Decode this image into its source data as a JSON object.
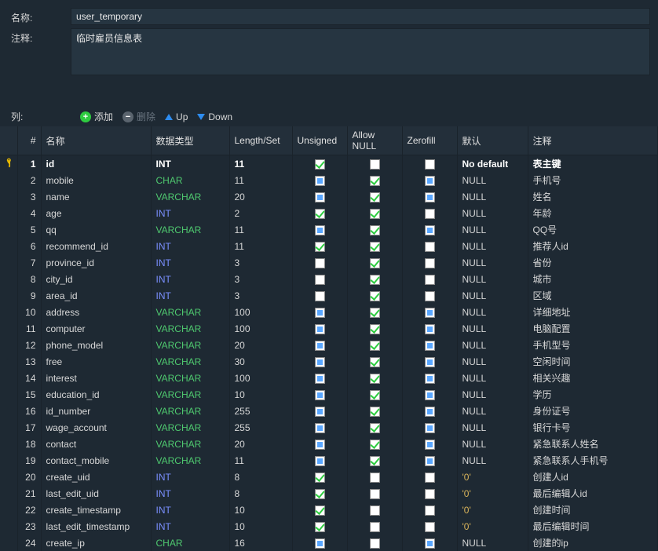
{
  "labels": {
    "name": "名称:",
    "comment": "注释:",
    "columns": "列:"
  },
  "form": {
    "name_value": "user_temporary",
    "comment_value": "临时雇员信息表"
  },
  "toolbar": {
    "add": "添加",
    "del": "删除",
    "up": "Up",
    "down": "Down"
  },
  "headers": {
    "num": "#",
    "name": "名称",
    "datatype": "数据类型",
    "length": "Length/Set",
    "unsigned": "Unsigned",
    "allownull": "Allow NULL",
    "zerofill": "Zerofill",
    "default": "默认",
    "comment": "注释"
  },
  "rows": [
    {
      "n": 1,
      "key": true,
      "name": "id",
      "type": "INT",
      "tclass": "dt-int",
      "len": "11",
      "unsigned": true,
      "null": false,
      "zero": false,
      "def": "No default",
      "defc": "",
      "com": "表主键",
      "sel": true
    },
    {
      "n": 2,
      "name": "mobile",
      "type": "CHAR",
      "tclass": "dt-char",
      "len": "11",
      "unsigned": false,
      "null": true,
      "zero": false,
      "def": "NULL",
      "com": "手机号"
    },
    {
      "n": 3,
      "name": "name",
      "type": "VARCHAR",
      "tclass": "dt-varchar",
      "len": "20",
      "unsigned": false,
      "null": true,
      "zero": false,
      "def": "NULL",
      "com": "姓名"
    },
    {
      "n": 4,
      "name": "age",
      "type": "INT",
      "tclass": "dt-int",
      "len": "2",
      "unsigned": true,
      "null": true,
      "zero": false,
      "def": "NULL",
      "com": "年龄"
    },
    {
      "n": 5,
      "name": "qq",
      "type": "VARCHAR",
      "tclass": "dt-varchar",
      "len": "11",
      "unsigned": false,
      "null": true,
      "zero": false,
      "def": "NULL",
      "com": "QQ号"
    },
    {
      "n": 6,
      "name": "recommend_id",
      "type": "INT",
      "tclass": "dt-int",
      "len": "11",
      "unsigned": true,
      "null": true,
      "zero": false,
      "def": "NULL",
      "com": "推荐人id"
    },
    {
      "n": 7,
      "name": "province_id",
      "type": "INT",
      "tclass": "dt-int",
      "len": "3",
      "unsigned": false,
      "null": true,
      "zero": false,
      "def": "NULL",
      "com": "省份"
    },
    {
      "n": 8,
      "name": "city_id",
      "type": "INT",
      "tclass": "dt-int",
      "len": "3",
      "unsigned": false,
      "null": true,
      "zero": false,
      "def": "NULL",
      "com": "城市"
    },
    {
      "n": 9,
      "name": "area_id",
      "type": "INT",
      "tclass": "dt-int",
      "len": "3",
      "unsigned": false,
      "null": true,
      "zero": false,
      "def": "NULL",
      "com": "区域"
    },
    {
      "n": 10,
      "name": "address",
      "type": "VARCHAR",
      "tclass": "dt-varchar",
      "len": "100",
      "unsigned": false,
      "null": true,
      "zero": false,
      "def": "NULL",
      "com": "详细地址"
    },
    {
      "n": 11,
      "name": "computer",
      "type": "VARCHAR",
      "tclass": "dt-varchar",
      "len": "100",
      "unsigned": false,
      "null": true,
      "zero": false,
      "def": "NULL",
      "com": "电脑配置"
    },
    {
      "n": 12,
      "name": "phone_model",
      "type": "VARCHAR",
      "tclass": "dt-varchar",
      "len": "20",
      "unsigned": false,
      "null": true,
      "zero": false,
      "def": "NULL",
      "com": "手机型号"
    },
    {
      "n": 13,
      "name": "free",
      "type": "VARCHAR",
      "tclass": "dt-varchar",
      "len": "30",
      "unsigned": false,
      "null": true,
      "zero": false,
      "def": "NULL",
      "com": "空闲时间"
    },
    {
      "n": 14,
      "name": "interest",
      "type": "VARCHAR",
      "tclass": "dt-varchar",
      "len": "100",
      "unsigned": false,
      "null": true,
      "zero": false,
      "def": "NULL",
      "com": "相关兴趣"
    },
    {
      "n": 15,
      "name": "education_id",
      "type": "VARCHAR",
      "tclass": "dt-varchar",
      "len": "10",
      "unsigned": false,
      "null": true,
      "zero": false,
      "def": "NULL",
      "com": "学历"
    },
    {
      "n": 16,
      "name": "id_number",
      "type": "VARCHAR",
      "tclass": "dt-varchar",
      "len": "255",
      "unsigned": false,
      "null": true,
      "zero": false,
      "def": "NULL",
      "com": "身份证号"
    },
    {
      "n": 17,
      "name": "wage_account",
      "type": "VARCHAR",
      "tclass": "dt-varchar",
      "len": "255",
      "unsigned": false,
      "null": true,
      "zero": false,
      "def": "NULL",
      "com": "银行卡号"
    },
    {
      "n": 18,
      "name": "contact",
      "type": "VARCHAR",
      "tclass": "dt-varchar",
      "len": "20",
      "unsigned": false,
      "null": true,
      "zero": false,
      "def": "NULL",
      "com": "紧急联系人姓名"
    },
    {
      "n": 19,
      "name": "contact_mobile",
      "type": "VARCHAR",
      "tclass": "dt-varchar",
      "len": "11",
      "unsigned": false,
      "null": true,
      "zero": false,
      "def": "NULL",
      "com": "紧急联系人手机号"
    },
    {
      "n": 20,
      "name": "create_uid",
      "type": "INT",
      "tclass": "dt-int",
      "len": "8",
      "unsigned": true,
      "null": false,
      "zero": false,
      "def": "'0'",
      "defc": "def-str",
      "com": "创建人id"
    },
    {
      "n": 21,
      "name": "last_edit_uid",
      "type": "INT",
      "tclass": "dt-int",
      "len": "8",
      "unsigned": true,
      "null": false,
      "zero": false,
      "def": "'0'",
      "defc": "def-str",
      "com": "最后编辑人id"
    },
    {
      "n": 22,
      "name": "create_timestamp",
      "type": "INT",
      "tclass": "dt-int",
      "len": "10",
      "unsigned": true,
      "null": false,
      "zero": false,
      "def": "'0'",
      "defc": "def-str",
      "com": "创建时间"
    },
    {
      "n": 23,
      "name": "last_edit_timestamp",
      "type": "INT",
      "tclass": "dt-int",
      "len": "10",
      "unsigned": true,
      "null": false,
      "zero": false,
      "def": "'0'",
      "defc": "def-str",
      "com": "最后编辑时间"
    },
    {
      "n": 24,
      "name": "create_ip",
      "type": "CHAR",
      "tclass": "dt-char",
      "len": "16",
      "unsigned": false,
      "null": false,
      "zero": false,
      "def": "NULL",
      "com": "创建的ip"
    }
  ]
}
